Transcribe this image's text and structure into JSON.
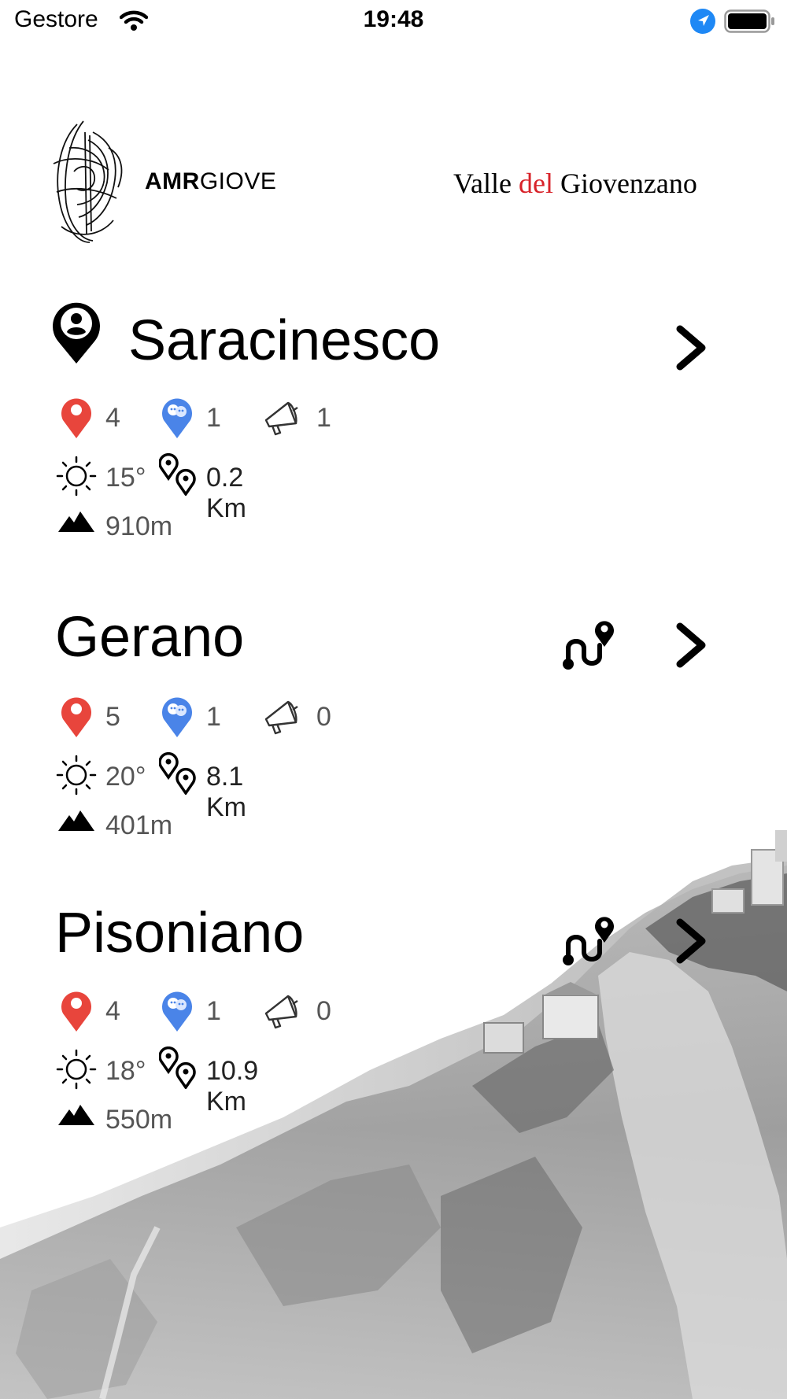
{
  "status_bar": {
    "carrier": "Gestore",
    "time": "19:48"
  },
  "header": {
    "logo_bold": "AMR",
    "logo_light": "GIOVE",
    "region_part1": "Valle ",
    "region_part2": "del",
    "region_part3": " Giovenzano"
  },
  "places": [
    {
      "name": "Saracinesco",
      "pins": "4",
      "theatre": "1",
      "announcements": "1",
      "temperature": "15°",
      "distance": "0.2 Km",
      "altitude": "910m"
    },
    {
      "name": "Gerano",
      "pins": "5",
      "theatre": "1",
      "announcements": "0",
      "temperature": "20°",
      "distance": "8.1 Km",
      "altitude": "401m"
    },
    {
      "name": "Pisoniano",
      "pins": "4",
      "theatre": "1",
      "announcements": "0",
      "temperature": "18°",
      "distance": "10.9 Km",
      "altitude": "550m"
    }
  ],
  "colors": {
    "pin_red": "#e8453c",
    "pin_blue": "#4a84e8",
    "accent_red": "#d8232a"
  }
}
